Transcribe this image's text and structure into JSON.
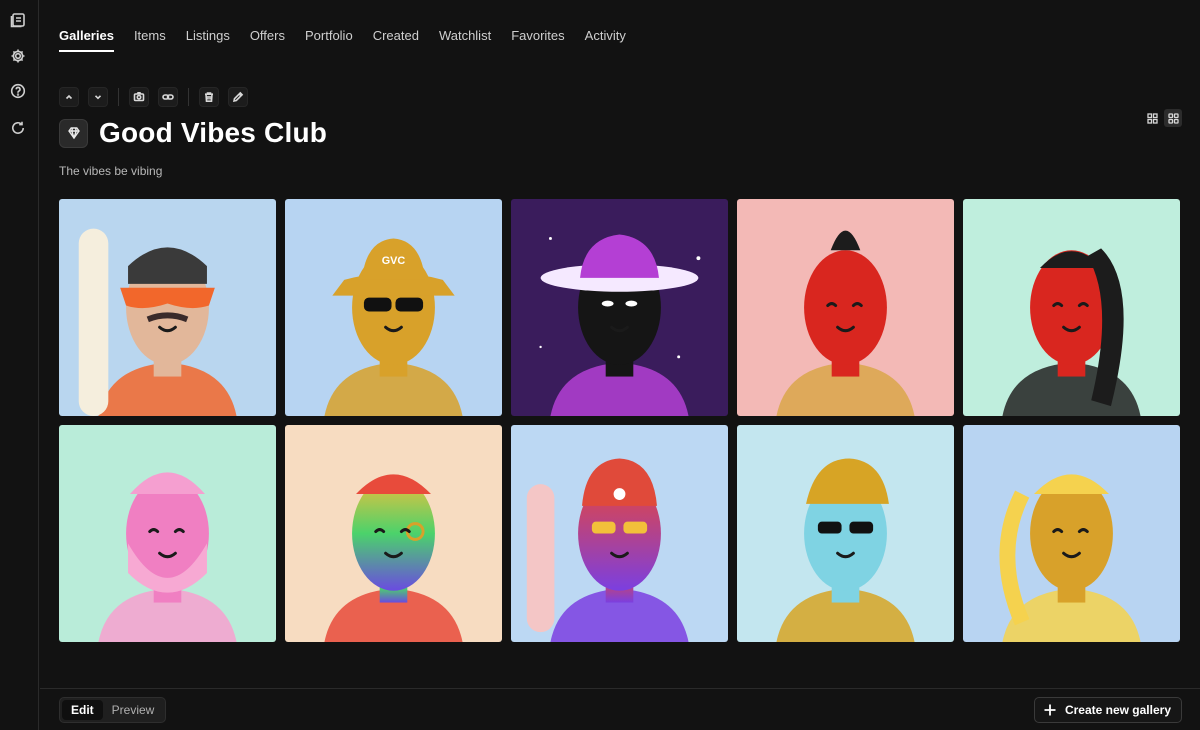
{
  "sidebar": {
    "items": [
      {
        "icon": "collection-icon"
      },
      {
        "icon": "gear-icon"
      },
      {
        "icon": "help-icon"
      },
      {
        "icon": "refresh-icon"
      }
    ]
  },
  "tabs": [
    {
      "label": "Galleries",
      "active": true
    },
    {
      "label": "Items"
    },
    {
      "label": "Listings"
    },
    {
      "label": "Offers"
    },
    {
      "label": "Portfolio"
    },
    {
      "label": "Created"
    },
    {
      "label": "Watchlist"
    },
    {
      "label": "Favorites"
    },
    {
      "label": "Activity"
    }
  ],
  "toolbar": {
    "icons": [
      "chevron-up-icon",
      "chevron-down-icon",
      "camera-icon",
      "link-icon",
      "trash-icon",
      "pencil-icon"
    ]
  },
  "gallery": {
    "title": "Good Vibes Club",
    "description": "The vibes be vibing",
    "icon": "diamond-icon"
  },
  "view": {
    "options": [
      "grid-small-icon",
      "grid-large-icon"
    ],
    "active": "grid-large-icon"
  },
  "nfts": [
    {
      "bg": "#b9d6ef",
      "skin": "#e2b79a",
      "accent": "#f2672b",
      "feature": "shades",
      "hair": "#3a3a3a"
    },
    {
      "bg": "#b7d4f2",
      "skin": "#d8a12a",
      "accent": "#d8a12a",
      "feature": "bucket-hat",
      "hat_text": "GVC"
    },
    {
      "bg": "#3a1c5c",
      "skin": "#151515",
      "accent": "#b43fd4",
      "feature": "fedora"
    },
    {
      "bg": "#f3b9b6",
      "skin": "#d9261f",
      "accent": "#d9a64a",
      "feature": "mohawk",
      "hair": "#1c1c1c"
    },
    {
      "bg": "#bfeedd",
      "skin": "#d9261f",
      "accent": "#222222",
      "feature": "ponytail",
      "hair": "#1c1c1c"
    },
    {
      "bg": "#b9ecd9",
      "skin": "#f07fc2",
      "accent": "#f7a1cf",
      "feature": "beard"
    },
    {
      "bg": "#f7dcc1",
      "skin": "#f2c03a",
      "accent": "#e84b3b",
      "feature": "rainbow"
    },
    {
      "bg": "#bcd8f3",
      "skin": "#e8463a",
      "accent": "#7b3fe0",
      "feature": "beanie"
    },
    {
      "bg": "#c3e6ef",
      "skin": "#7fd3e3",
      "accent": "#d7a425",
      "feature": "gold-hair"
    },
    {
      "bg": "#b8d4f2",
      "skin": "#d8a12a",
      "accent": "#f5d24e",
      "feature": "gold-ponytail"
    }
  ],
  "bottom_bar": {
    "modes": [
      {
        "label": "Edit",
        "active": true
      },
      {
        "label": "Preview"
      }
    ],
    "create_button": "Create new gallery"
  }
}
